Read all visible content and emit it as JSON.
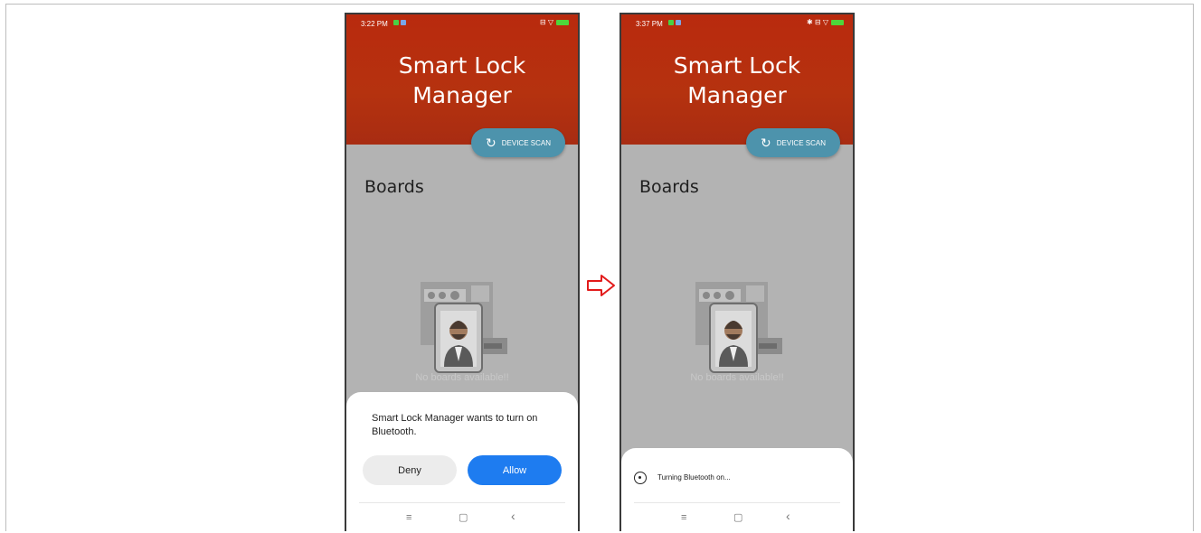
{
  "screens": [
    {
      "status_time": "3:22 PM",
      "status_icons": "⊟ ▽",
      "app_title": "Smart Lock Manager",
      "scan_button": "DEVICE SCAN",
      "section_title": "Boards",
      "empty_text": "No boards available!!",
      "dialog": {
        "message": "Smart Lock Manager wants to turn on Bluetooth.",
        "deny": "Deny",
        "allow": "Allow"
      },
      "nav": {
        "menu": "≡",
        "home": "▢",
        "back": "‹"
      }
    },
    {
      "status_time": "3:37 PM",
      "status_icons": "✱ ⊟ ▽",
      "app_title": "Smart Lock Manager",
      "scan_button": "DEVICE SCAN",
      "section_title": "Boards",
      "empty_text": "No boards available!!",
      "progress": {
        "message": "Turning Bluetooth on..."
      },
      "nav": {
        "menu": "≡",
        "home": "▢",
        "back": "‹"
      }
    }
  ],
  "colors": {
    "header": "#b5320f",
    "scan_button": "#4d93ac",
    "allow_button": "#1e7cf0",
    "arrow": "#e21b1b"
  }
}
